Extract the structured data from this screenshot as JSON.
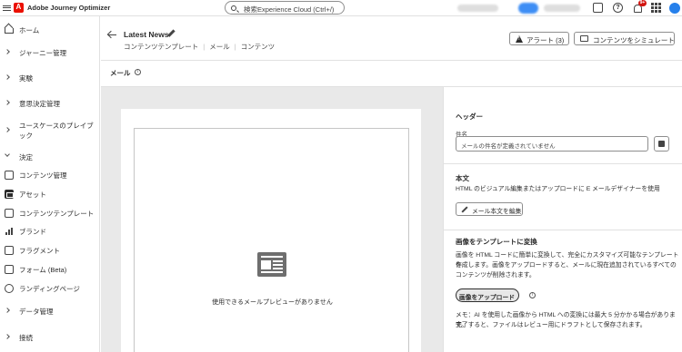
{
  "topbar": {
    "app_name": "Adobe Journey Optimizer",
    "search_placeholder": "検索Experience Cloud (Ctrl+/)",
    "notification_count": "9+",
    "help_label": "?"
  },
  "nav": {
    "items": [
      {
        "label": "ホーム",
        "icon": "home-icon"
      },
      {
        "label": "ジャーニー管理",
        "icon": "chevron-right-icon"
      },
      {
        "label": "実験",
        "icon": "chevron-right-icon"
      },
      {
        "label": "意思決定管理",
        "icon": "chevron-right-icon"
      },
      {
        "label": "ユースケースのプレイブック",
        "icon": "chevron-right-icon"
      },
      {
        "label": "決定",
        "icon": "chevron-down-icon"
      },
      {
        "label": "コンテンツ管理",
        "icon": "content-icon"
      },
      {
        "label": "アセット",
        "icon": "assets-icon",
        "active": true
      },
      {
        "label": "コンテンツテンプレート",
        "icon": "template-icon"
      },
      {
        "label": "ブランド",
        "icon": "brand-icon"
      },
      {
        "label": "フラグメント",
        "icon": "fragment-icon"
      },
      {
        "label": "フォーム (Beta)",
        "icon": "form-icon"
      },
      {
        "label": "ランディングページ",
        "icon": "globe-icon"
      },
      {
        "label": "データ管理",
        "icon": "chevron-right-icon"
      },
      {
        "label": "接続",
        "icon": "chevron-right-icon"
      }
    ]
  },
  "header": {
    "title": "Latest News",
    "breadcrumbs": [
      "コンテンツテンプレート",
      "メール",
      "コンテンツ"
    ],
    "alert_button": "アラート (3)",
    "simulate_button": "コンテンツをシミュレート"
  },
  "section": {
    "label": "メール",
    "info": "i"
  },
  "canvas": {
    "empty_text": "使用できるメールプレビューがありません"
  },
  "panel": {
    "header_title": "ヘッダー",
    "subject_label": "件名",
    "subject_placeholder": "メールの件名が定義されていません",
    "body_title": "本文",
    "body_desc": "HTML のビジュアル編集またはアップロードに E メールデザイナーを使用",
    "edit_body_button": "メール本文を編集",
    "convert_title": "画像をテンプレートに変換",
    "convert_desc_1": "画像を HTML コードに簡単に変換して、完全にカスタマイズ可能なテンプレートを",
    "convert_desc_2": "作成します。画像をアップロードすると、メールに現在追加されているすべての",
    "convert_desc_3": "コンテンツが削除されます。",
    "upload_button": "画像をアップロード",
    "note_1": "メモ：AI を使用した画像から HTML への変換には最大 5 分かかる場合があります。",
    "note_2": "完了すると、ファイルはレビュー用にドラフトとして保存されます。"
  }
}
